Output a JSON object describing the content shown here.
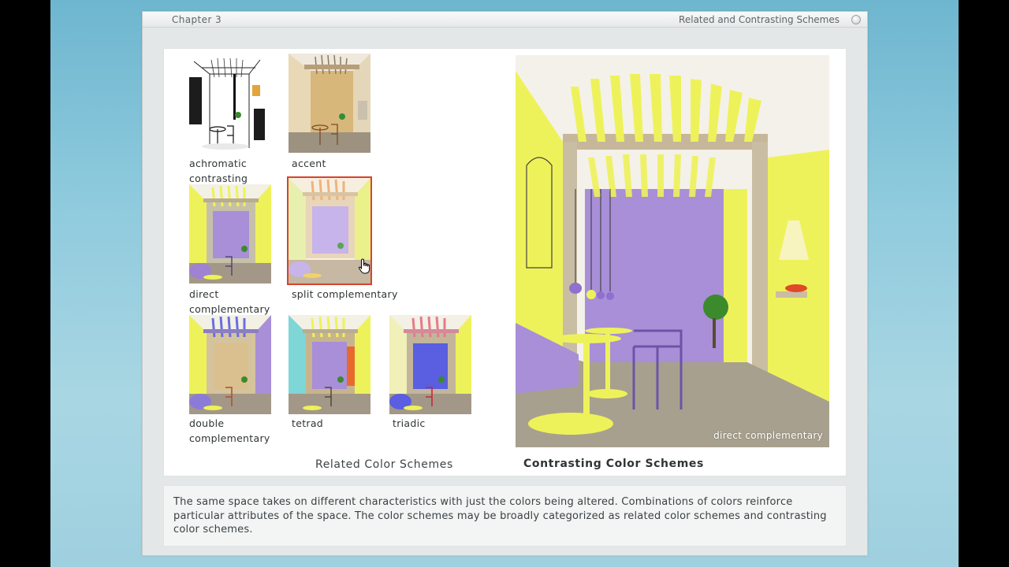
{
  "window": {
    "chapter": "Chapter 3",
    "section_title": "Related and Contrasting Schemes"
  },
  "thumbnails": [
    {
      "label": "achromatic\ncontrasting",
      "icon": "scheme-achromatic-contrasting-image"
    },
    {
      "label": "accent",
      "icon": "scheme-accent-image"
    },
    {
      "label": "direct\ncomplementary",
      "icon": "scheme-direct-complementary-image"
    },
    {
      "label": "split complementary",
      "icon": "scheme-split-complementary-image",
      "selected": true
    },
    {
      "label": "double\ncomplementary",
      "icon": "scheme-double-complementary-image"
    },
    {
      "label": "tetrad",
      "icon": "scheme-tetrad-image"
    },
    {
      "label": "triadic",
      "icon": "scheme-triadic-image"
    }
  ],
  "captions": {
    "related": "Related Color Schemes",
    "contrasting": "Contrasting Color Schemes"
  },
  "preview": {
    "label": "direct complementary"
  },
  "description": "The same space takes on different characteristics with just the colors being altered.  Combinations of colors reinforce particular attributes of the space. The color schemes may be broadly categorized as related color schemes and contrasting color schemes.",
  "colors": {
    "selection_border": "#d9432b",
    "wall_violet": "#a88fd8",
    "yellow": "#eef25a"
  }
}
